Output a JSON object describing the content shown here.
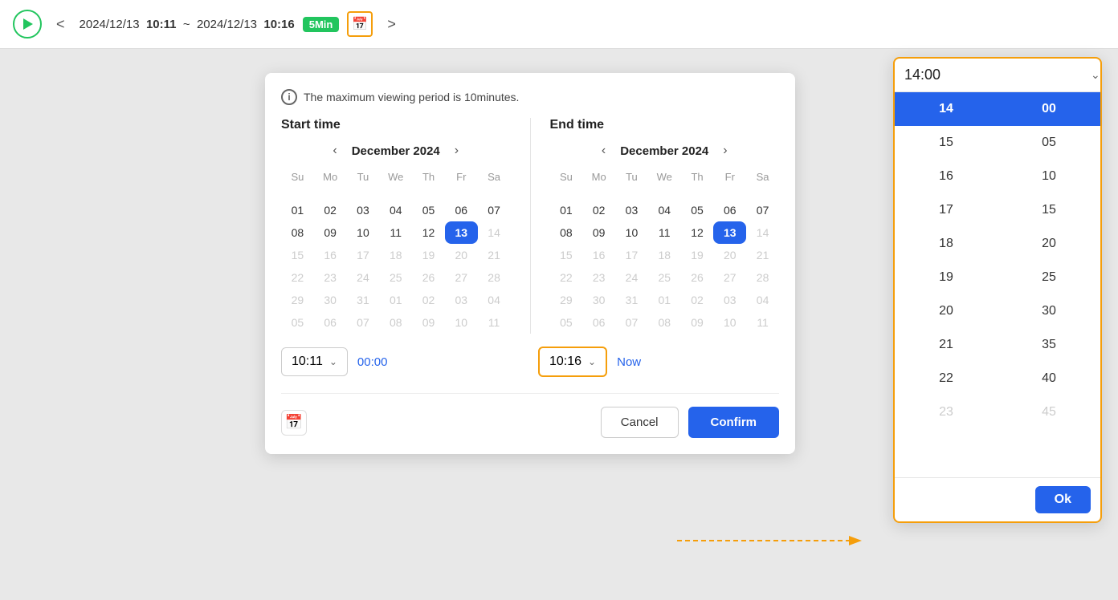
{
  "topbar": {
    "play_label": "",
    "time_range": "2024/12/13",
    "start_time_bold": "10:11",
    "separator": "~",
    "end_date": "2024/12/13",
    "end_time_bold": "10:16",
    "badge_label": "5Min",
    "nav_prev": "<",
    "nav_next": ">"
  },
  "dialog": {
    "info_text": "The maximum viewing period is 10minutes.",
    "start_label": "Start time",
    "end_label": "End time",
    "start_month": "December 2024",
    "end_month": "December 2024",
    "day_names": [
      "Su",
      "Mo",
      "Tu",
      "We",
      "Th",
      "Fr",
      "Sa"
    ],
    "start_calendar": [
      [
        "",
        "",
        "",
        "",
        "",
        "",
        ""
      ],
      [
        "01",
        "02",
        "03",
        "04",
        "05",
        "06",
        "07"
      ],
      [
        "08",
        "09",
        "10",
        "11",
        "12",
        "13",
        "14"
      ],
      [
        "15",
        "16",
        "17",
        "18",
        "19",
        "20",
        "21"
      ],
      [
        "22",
        "23",
        "24",
        "25",
        "26",
        "27",
        "28"
      ],
      [
        "29",
        "30",
        "31",
        "01",
        "02",
        "03",
        "04"
      ],
      [
        "05",
        "06",
        "07",
        "08",
        "09",
        "10",
        "11"
      ]
    ],
    "start_selected": "13",
    "start_future": [
      "14",
      "15",
      "16",
      "17",
      "18",
      "19",
      "20",
      "21",
      "22",
      "23",
      "24",
      "25",
      "26",
      "27",
      "28",
      "29",
      "30",
      "31"
    ],
    "start_muted_bottom": [
      "01",
      "02",
      "03",
      "04",
      "05",
      "06",
      "07",
      "08",
      "09",
      "10",
      "11"
    ],
    "end_calendar": [
      [
        "",
        "",
        "",
        "",
        "",
        "",
        ""
      ],
      [
        "01",
        "02",
        "03",
        "04",
        "05",
        "06",
        "07"
      ],
      [
        "08",
        "09",
        "10",
        "11",
        "12",
        "13",
        "14"
      ],
      [
        "15",
        "16",
        "17",
        "18",
        "19",
        "20",
        "21"
      ],
      [
        "22",
        "23",
        "24",
        "25",
        "26",
        "27",
        "28"
      ],
      [
        "29",
        "30",
        "31",
        "01",
        "02",
        "03",
        "04"
      ],
      [
        "05",
        "06",
        "07",
        "08",
        "09",
        "10",
        "11"
      ]
    ],
    "end_selected": "13",
    "start_time_val": "10:11",
    "end_time_val": "10:16",
    "duration_text": "00:00",
    "now_label": "Now",
    "cancel_label": "Cancel",
    "confirm_label": "Confirm"
  },
  "time_picker": {
    "input_val": "14:00",
    "hours": [
      "14",
      "15",
      "16",
      "17",
      "18",
      "19",
      "20",
      "21",
      "22",
      "23"
    ],
    "minutes": [
      "00",
      "05",
      "10",
      "15",
      "20",
      "25",
      "30",
      "35",
      "40",
      "45"
    ],
    "selected_hour": "14",
    "selected_minute": "00",
    "ok_label": "Ok"
  }
}
